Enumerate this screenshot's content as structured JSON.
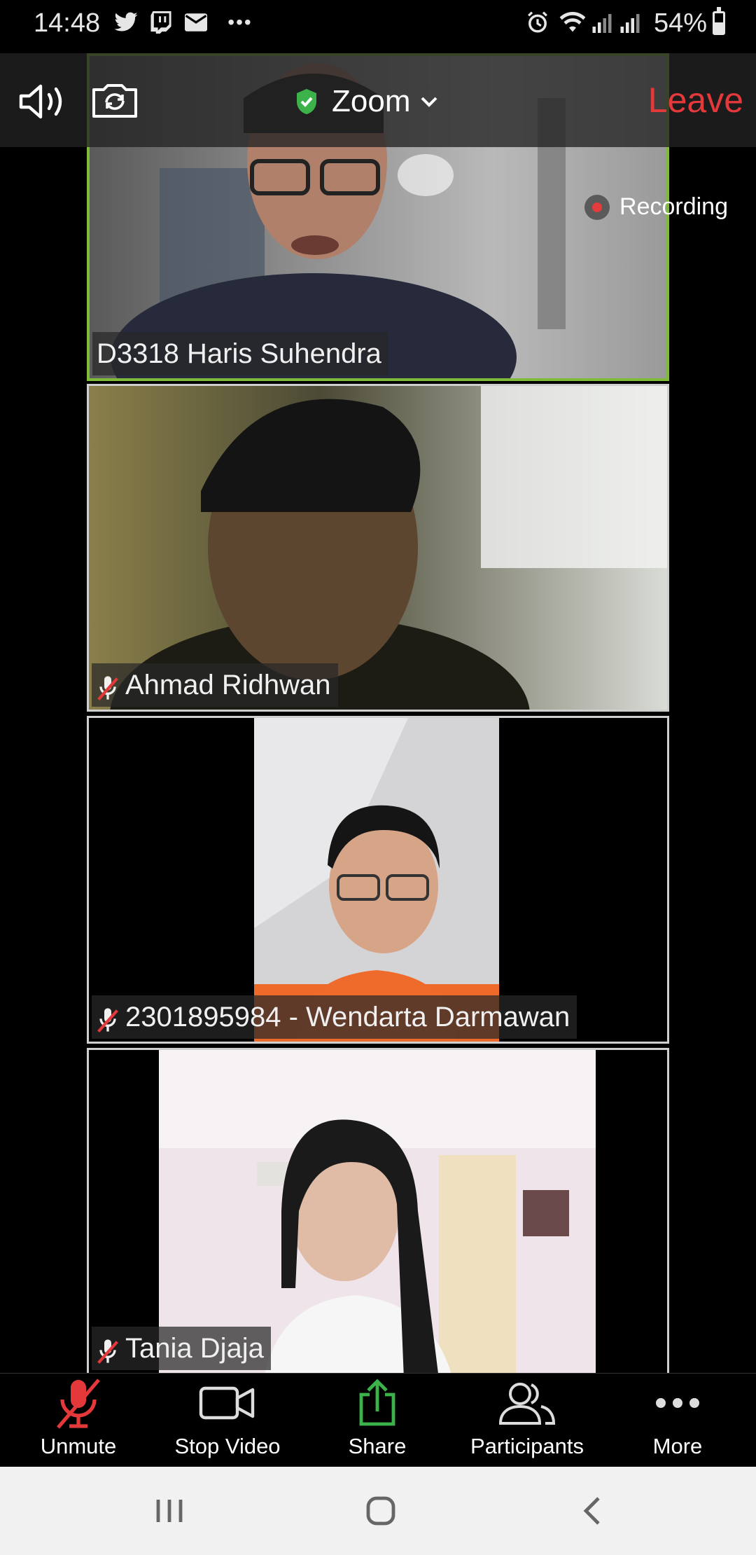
{
  "status_bar": {
    "time": "14:48",
    "notification_icons": [
      "twitter-icon",
      "twitch-icon",
      "mail-icon",
      "more-dots-icon"
    ],
    "system_icons": [
      "alarm-icon",
      "wifi-icon",
      "signal-icon",
      "signal-icon"
    ],
    "battery_percent": "54%",
    "battery_level": 0.54
  },
  "meeting": {
    "title": "Zoom",
    "leave_label": "Leave",
    "recording_label": "Recording",
    "secure_badge_color": "#3bb34a",
    "leave_color": "#e4393b",
    "active_speaker_border_color": "#7fba3a"
  },
  "participants": [
    {
      "name": "D3318 Haris Suhendra",
      "muted": false,
      "active_speaker": true
    },
    {
      "name": "Ahmad Ridhwan",
      "muted": true,
      "active_speaker": false
    },
    {
      "name": "2301895984 - Wendarta Darmawan",
      "muted": true,
      "active_speaker": false
    },
    {
      "name": "Tania Djaja",
      "muted": true,
      "active_speaker": false
    }
  ],
  "toolbar": {
    "unmute": "Unmute",
    "stop_video": "Stop Video",
    "share": "Share",
    "participants": "Participants",
    "more": "More",
    "share_color": "#3bb34a",
    "mute_color": "#e4393b"
  },
  "nav_bar": {
    "buttons": [
      "recent-apps-icon",
      "home-icon",
      "back-icon"
    ]
  }
}
